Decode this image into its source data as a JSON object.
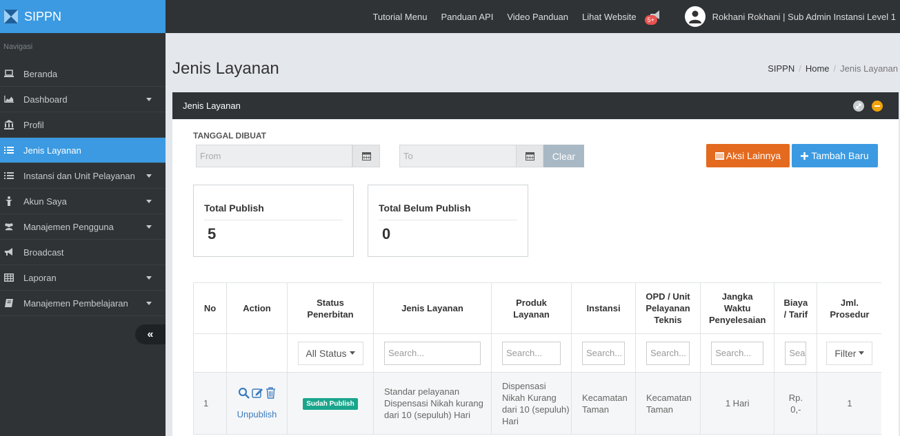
{
  "brand": {
    "title": "SIPPN"
  },
  "topnav": {
    "links": [
      "Tutorial Menu",
      "Panduan API",
      "Video Panduan",
      "Lihat Website"
    ],
    "notif_badge": "5+",
    "user": "Rokhani Rokhani | Sub Admin Instansi Level 1"
  },
  "sidebar": {
    "heading": "Navigasi",
    "items": [
      {
        "label": "Beranda",
        "icon": "laptop-icon"
      },
      {
        "label": "Dashboard",
        "icon": "area-chart-icon"
      },
      {
        "label": "Profil",
        "icon": "institution-icon"
      },
      {
        "label": "Jenis Layanan",
        "icon": "list-icon"
      },
      {
        "label": "Instansi dan Unit Pelayanan",
        "icon": "list-icon"
      },
      {
        "label": "Akun Saya",
        "icon": "user-icon"
      },
      {
        "label": "Manajemen Pengguna",
        "icon": "users-icon"
      },
      {
        "label": "Broadcast",
        "icon": "bullhorn-icon"
      },
      {
        "label": "Laporan",
        "icon": "table-icon"
      },
      {
        "label": "Manajemen Pembelajaran",
        "icon": "book-icon"
      }
    ],
    "collapse_icon": "«"
  },
  "page": {
    "title": "Jenis Layanan",
    "breadcrumb": [
      "SIPPN",
      "Home",
      "Jenis Layanan"
    ]
  },
  "panel": {
    "title": "Jenis Layanan",
    "date_label": "TANGGAL DIBUAT",
    "from_placeholder": "From",
    "to_placeholder": "To",
    "clear_label": "Clear",
    "aksi_label": "Aksi Lainnya",
    "tambah_label": "Tambah Baru"
  },
  "stats": {
    "publish_title": "Total Publish",
    "publish_value": "5",
    "unpublish_title": "Total Belum Publish",
    "unpublish_value": "0"
  },
  "table": {
    "headers": [
      "No",
      "Action",
      "Status Penerbitan",
      "Jenis Layanan",
      "Produk Layanan",
      "Instansi",
      "OPD / Unit Pelayanan Teknis",
      "Jangka Waktu Penyelesaian",
      "Biaya / Tarif",
      "Jml. Prosedur"
    ],
    "filters": {
      "status": "All Status",
      "search": "Search...",
      "search_short": "Sea",
      "filter": "Filter"
    },
    "rows": [
      {
        "no": "1",
        "action_link": "Unpublish",
        "status": "Sudah Publish",
        "jenis": "Standar pelayanan Dispensasi Nikah kurang dari 10 (sepuluh) Hari",
        "produk": "Dispensasi Nikah Kurang dari 10 (sepuluh) Hari",
        "instansi": "Kecamatan Taman",
        "opd": "Kecamatan Taman",
        "jangka": "1 Hari",
        "biaya": "Rp. 0,-",
        "prosedur": "1"
      }
    ]
  }
}
